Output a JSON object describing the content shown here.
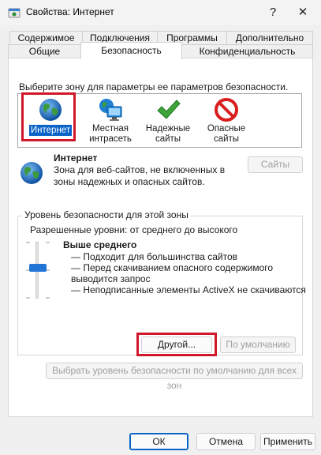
{
  "window": {
    "title": "Свойства: Интернет",
    "help_glyph": "?",
    "close_glyph": "✕"
  },
  "tabs": {
    "row_top": [
      "Содержимое",
      "Подключения",
      "Программы",
      "Дополнительно"
    ],
    "row_bottom": [
      "Общие",
      "Безопасность",
      "Конфиденциальность"
    ],
    "selected": "Безопасность"
  },
  "zones": {
    "prompt": "Выберите зону для параметры ее параметров безопасности.",
    "items": [
      {
        "label": "Интернет",
        "icon": "globe-icon",
        "selected": true
      },
      {
        "label": "Местная интрасеть",
        "icon": "network-monitor-icon",
        "selected": false
      },
      {
        "label": "Надежные сайты",
        "icon": "checkmark-icon",
        "selected": false
      },
      {
        "label": "Опасные сайты",
        "icon": "prohibited-icon",
        "selected": false
      }
    ]
  },
  "zone_info": {
    "title": "Интернет",
    "description": "Зона для веб-сайтов, не включенных в зоны надежных и опасных сайтов.",
    "sites_button": "Сайты"
  },
  "level": {
    "group_label": "Уровень безопасности для этой зоны",
    "allowed": "Разрешенные уровни: от среднего до высокого",
    "name": "Выше среднего",
    "bullets": [
      "— Подходит для большинства сайтов",
      "— Перед скачиванием опасного содержимого",
      "выводится запрос",
      "— Неподписанные элементы ActiveX не скачиваются"
    ],
    "custom_button": "Другой...",
    "default_button": "По умолчанию",
    "reset_all_button": "Выбрать уровень безопасности по умолчанию для всех зон"
  },
  "footer": {
    "ok": "ОК",
    "cancel": "Отмена",
    "apply": "Применить"
  },
  "colors": {
    "selection": "#0a64c8",
    "highlight": "#d0182a",
    "slider": "#1f74d6"
  }
}
